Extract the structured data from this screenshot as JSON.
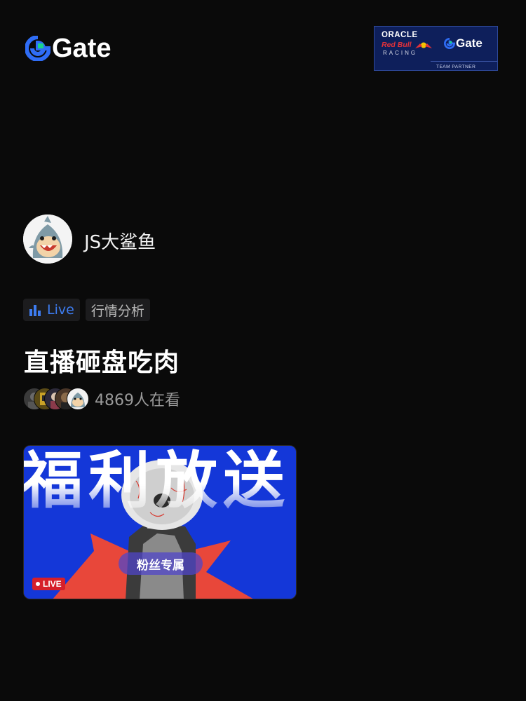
{
  "header": {
    "brand_name": "Gate",
    "partner_badge": {
      "oracle": "ORACLE",
      "redbull": "Red Bull",
      "racing": "RACING",
      "gate": "Gate",
      "team_partner": "TEAM PARTNER"
    }
  },
  "streamer": {
    "name": "JS大鲨鱼",
    "avatar_icon": "shark-avatar"
  },
  "tags": {
    "live_label": "Live",
    "topic_label": "行情分析"
  },
  "stream": {
    "title": "直播砸盘吃肉",
    "viewer_count": "4869人在看"
  },
  "cover": {
    "headline": "福利放送",
    "pill": "粉丝专属",
    "live_badge": "LIVE"
  },
  "colors": {
    "background": "#0a0a0a",
    "accent_blue": "#3d7cf0",
    "brand_green": "#19d38a",
    "live_red": "#d61f2a",
    "cover_blue": "#1437d8"
  }
}
